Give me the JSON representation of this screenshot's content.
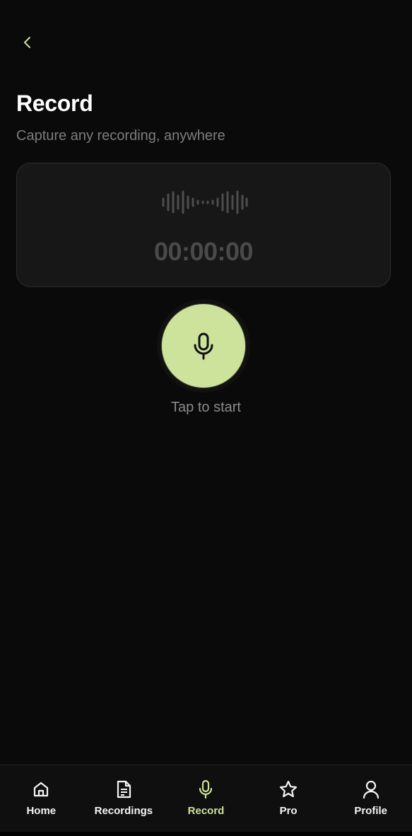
{
  "header": {
    "back_icon": "chevron-left-icon",
    "title": "Record",
    "subtitle": "Capture any recording, anywhere"
  },
  "recorder": {
    "waveform_icon": "waveform-icon",
    "timer": "00:00:00",
    "mic_icon": "microphone-icon",
    "hint": "Tap to start"
  },
  "tabs": [
    {
      "label": "Home",
      "icon": "home-icon",
      "active": false
    },
    {
      "label": "Recordings",
      "icon": "document-icon",
      "active": false
    },
    {
      "label": "Record",
      "icon": "microphone-icon",
      "active": true
    },
    {
      "label": "Pro",
      "icon": "star-icon",
      "active": false
    },
    {
      "label": "Profile",
      "icon": "user-icon",
      "active": false
    }
  ],
  "colors": {
    "background": "#0a0a0a",
    "accent": "#cde29b",
    "card": "#171717",
    "muted_text": "#7d7d7d",
    "timer_text": "#4a4a4a"
  }
}
